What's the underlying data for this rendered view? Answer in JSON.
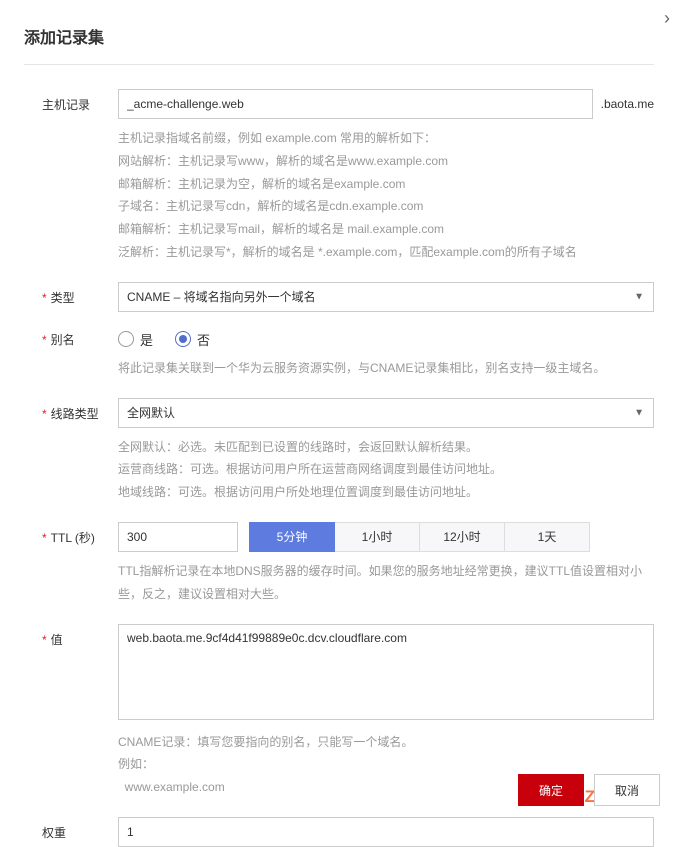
{
  "close_glyph": "›",
  "title": "添加记录集",
  "labels": {
    "host": "主机记录",
    "type": "类型",
    "alias": "别名",
    "line": "线路类型",
    "ttl": "TTL (秒)",
    "value": "值",
    "weight": "权重"
  },
  "host": {
    "value": "_acme-challenge.web",
    "suffix": ".baota.me"
  },
  "host_hint": [
    "主机记录指域名前缀，例如 example.com 常用的解析如下：",
    "网站解析：主机记录写www，解析的域名是www.example.com",
    "邮箱解析：主机记录为空，解析的域名是example.com",
    "子域名：主机记录写cdn，解析的域名是cdn.example.com",
    "邮箱解析：主机记录写mail，解析的域名是 mail.example.com",
    "泛解析：主机记录写*，解析的域名是 *.example.com，匹配example.com的所有子域名"
  ],
  "type": {
    "value": "CNAME – 将域名指向另外一个域名"
  },
  "alias": {
    "yes": "是",
    "no": "否",
    "selected": "no"
  },
  "alias_hint": "将此记录集关联到一个华为云服务资源实例，与CNAME记录集相比，别名支持一级主域名。",
  "line": {
    "value": "全网默认"
  },
  "line_hint": [
    "全网默认：必选。未匹配到已设置的线路时，会返回默认解析结果。",
    "运营商线路：可选。根据访问用户所在运营商网络调度到最佳访问地址。",
    "地域线路：可选。根据访问用户所处地理位置调度到最佳访问地址。"
  ],
  "ttl": {
    "value": "300",
    "buttons": [
      "5分钟",
      "1小时",
      "12小时",
      "1天"
    ],
    "active": 0
  },
  "ttl_hint": "TTL指解析记录在本地DNS服务器的缓存时间。如果您的服务地址经常更换，建议TTL值设置相对小些，反之，建议设置相对大些。",
  "value": {
    "text": "web.baota.me.9cf4d41f99889e0c.dcv.cloudflare.com"
  },
  "value_hint": [
    "CNAME记录：填写您要指向的别名，只能写一个域名。",
    "例如：",
    "  www.example.com"
  ],
  "weight": {
    "value": "1"
  },
  "footer": {
    "ok": "确定",
    "cancel": "取消"
  },
  "watermark": "DZ插件网"
}
